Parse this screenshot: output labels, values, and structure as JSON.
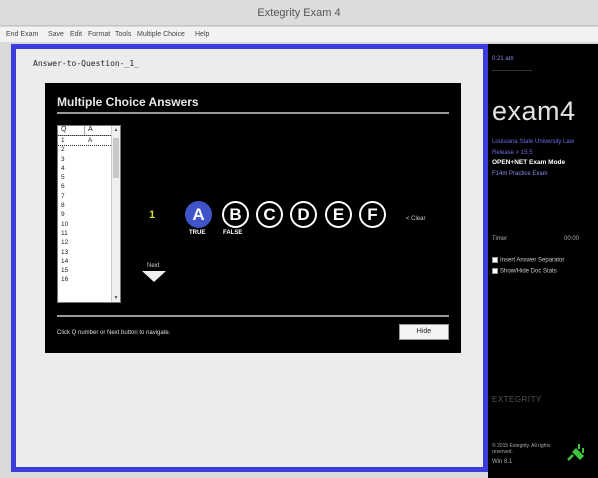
{
  "window": {
    "title": "Extegrity Exam 4"
  },
  "menu": [
    "End Exam",
    "Save",
    "Edit",
    "Format",
    "Tools",
    "Multiple Choice",
    "Help"
  ],
  "editor": {
    "answer_text": "Answer-to-Question-_1_"
  },
  "mc_panel": {
    "title": "Multiple Choice Answers",
    "list_header": {
      "q": "Q",
      "a": "A"
    },
    "rows": [
      {
        "q": "1",
        "a": "A"
      },
      {
        "q": "2",
        "a": ""
      },
      {
        "q": "3",
        "a": ""
      },
      {
        "q": "4",
        "a": ""
      },
      {
        "q": "5",
        "a": ""
      },
      {
        "q": "6",
        "a": ""
      },
      {
        "q": "7",
        "a": ""
      },
      {
        "q": "8",
        "a": ""
      },
      {
        "q": "9",
        "a": ""
      },
      {
        "q": "10",
        "a": ""
      },
      {
        "q": "11",
        "a": ""
      },
      {
        "q": "12",
        "a": ""
      },
      {
        "q": "13",
        "a": ""
      },
      {
        "q": "14",
        "a": ""
      },
      {
        "q": "15",
        "a": ""
      },
      {
        "q": "16",
        "a": ""
      }
    ],
    "current_question": "1",
    "choices": [
      "A",
      "B",
      "C",
      "D",
      "E",
      "F"
    ],
    "selected_choice": "A",
    "true_label": "TRUE",
    "false_label": "FALSE",
    "clear_label": "< Clear",
    "next_label": "Next",
    "hint": "Click Q number or Next button to navigate.",
    "hide_label": "Hide"
  },
  "sidebar": {
    "time": "0:21 am",
    "logo": "exam4",
    "school": "Louisiana State University Law",
    "release": "Release > 15.5",
    "mode": "OPEN+NET Exam Mode",
    "exam_name": "F14m Practice Exam",
    "timer_label": "Timer",
    "timer_value": "00:00",
    "checkbox_1": "Insert Answer Separator",
    "checkbox_2": "Show/Hide Doc Stats",
    "brand": "EXTEGRITY",
    "copyright": "© 2015 Extegrity. All rights reserved.",
    "winver": "Win 8.1"
  },
  "colors": {
    "frame_border": "#3d3ddc",
    "selected_choice": "#3f54c8",
    "question_number": "#d9d93a",
    "sidebar_accent": "#6a6ae8",
    "plug_icon": "#3fc43f"
  }
}
